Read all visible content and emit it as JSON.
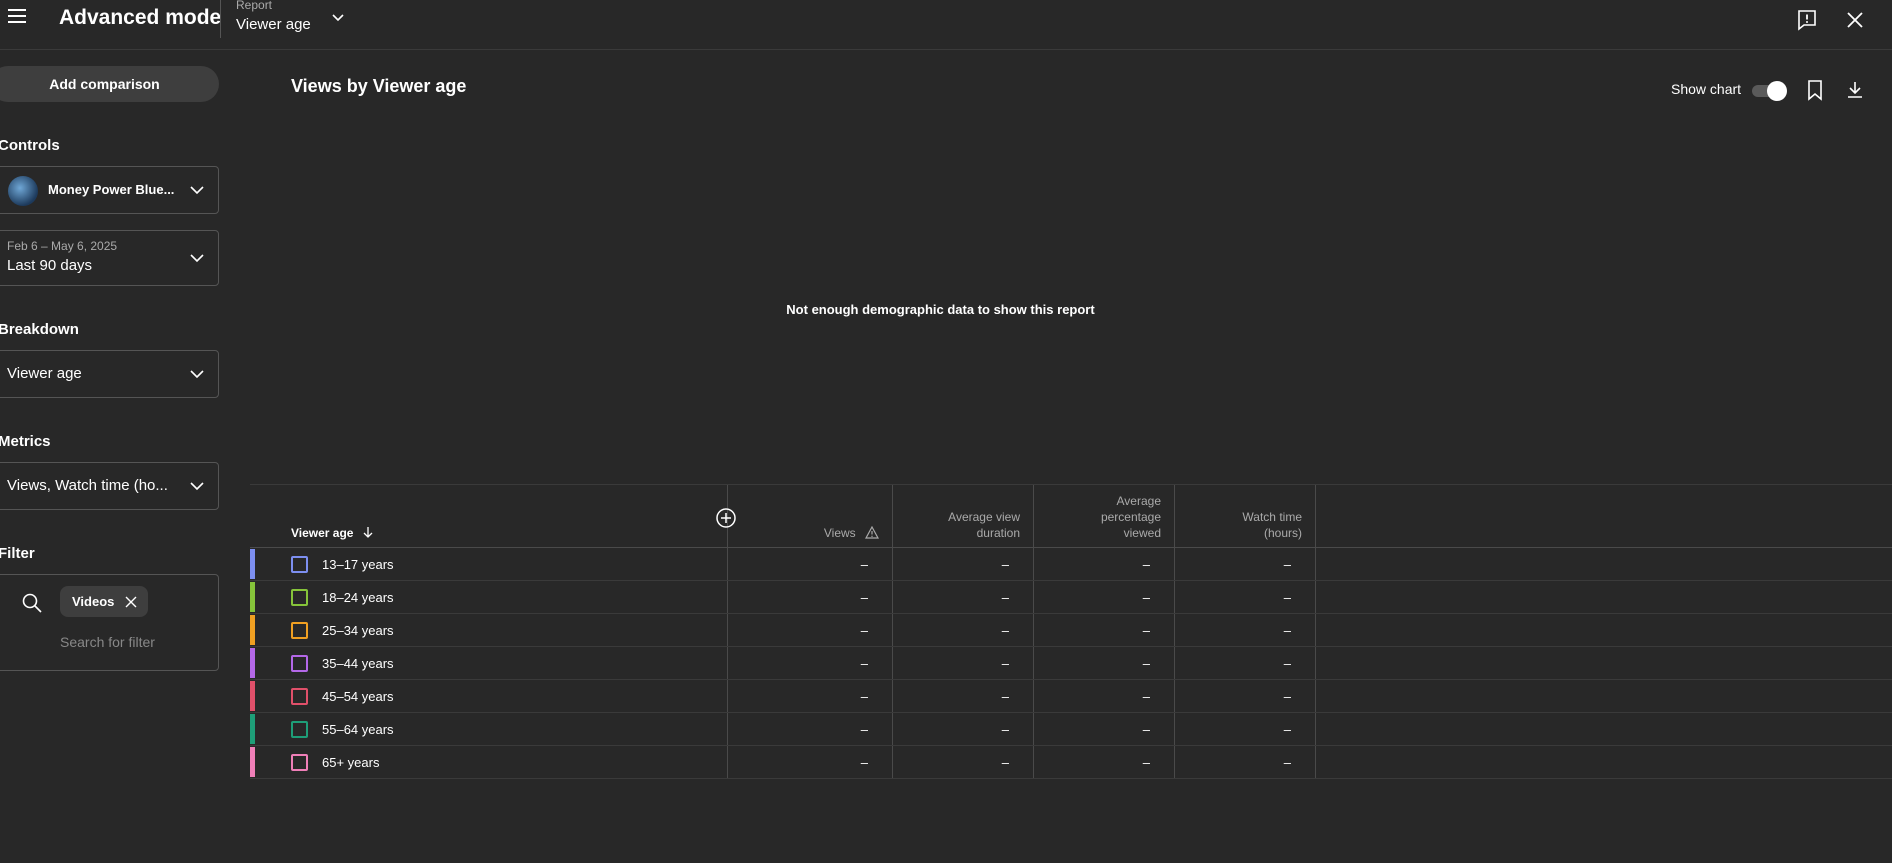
{
  "header": {
    "app_title": "Advanced mode",
    "report_caption": "Report",
    "report_value": "Viewer age",
    "icons": [
      "menu-icon",
      "chevron-down-icon",
      "feedback-icon",
      "close-icon"
    ]
  },
  "sidebar": {
    "add_comparison": "Add comparison",
    "controls_label": "Controls",
    "channel_name": "Money Power Blue...",
    "date_range": "Feb 6 – May 6, 2025",
    "date_label": "Last 90 days",
    "breakdown_label": "Breakdown",
    "breakdown_value": "Viewer age",
    "metrics_label": "Metrics",
    "metrics_value": "Views, Watch time (ho...",
    "filter_label": "Filter",
    "filter_chip": "Videos",
    "filter_placeholder": "Search for filter"
  },
  "main": {
    "chart_title": "Views by Viewer age",
    "show_chart_label": "Show chart",
    "show_chart_on": true,
    "no_data_message": "Not enough demographic data to show this report",
    "icons": [
      "bookmark-icon",
      "download-icon"
    ]
  },
  "table": {
    "columns": {
      "breakdown": "Viewer age",
      "views": "Views",
      "avg_view_duration_1": "Average view",
      "avg_view_duration_2": "duration",
      "avg_pct_1": "Average",
      "avg_pct_2": "percentage",
      "avg_pct_3": "viewed",
      "watch_time_1": "Watch time",
      "watch_time_2": "(hours)"
    },
    "rows": [
      {
        "label": "13–17 years",
        "color": "#7d8ff0",
        "views": "–",
        "avg_view_duration": "–",
        "avg_pct": "–",
        "watch_time": "–"
      },
      {
        "label": "18–24 years",
        "color": "#86c43a",
        "views": "–",
        "avg_view_duration": "–",
        "avg_pct": "–",
        "watch_time": "–"
      },
      {
        "label": "25–34 years",
        "color": "#f0a022",
        "views": "–",
        "avg_view_duration": "–",
        "avg_pct": "–",
        "watch_time": "–"
      },
      {
        "label": "35–44 years",
        "color": "#b468e8",
        "views": "–",
        "avg_view_duration": "–",
        "avg_pct": "–",
        "watch_time": "–"
      },
      {
        "label": "45–54 years",
        "color": "#e0506a",
        "views": "–",
        "avg_view_duration": "–",
        "avg_pct": "–",
        "watch_time": "–"
      },
      {
        "label": "55–64 years",
        "color": "#1e9e78",
        "views": "–",
        "avg_view_duration": "–",
        "avg_pct": "–",
        "watch_time": "–"
      },
      {
        "label": "65+ years",
        "color": "#f07fb8",
        "views": "–",
        "avg_view_duration": "–",
        "avg_pct": "–",
        "watch_time": "–"
      }
    ]
  }
}
